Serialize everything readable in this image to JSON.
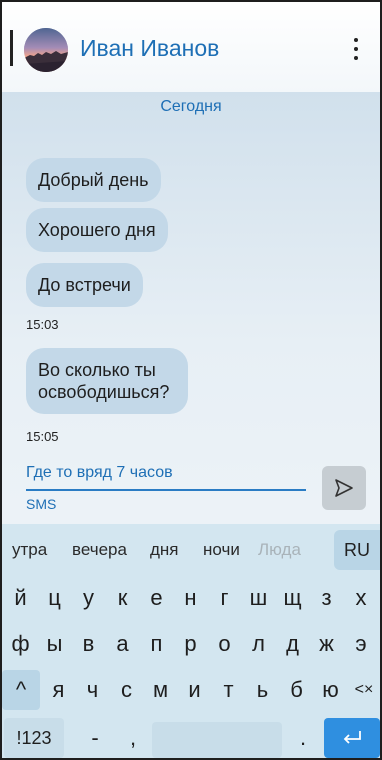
{
  "header": {
    "contact_name": "Иван Иванов"
  },
  "chat": {
    "date_separator": "Сегодня",
    "messages": [
      {
        "text": "Добрый день"
      },
      {
        "text": "Хорошего дня"
      },
      {
        "text": "До встречи",
        "time": "15:03"
      },
      {
        "text": "Во сколько ты освободишься?",
        "time": "15:05"
      }
    ]
  },
  "composer": {
    "value": "Где то вряд 7 часов",
    "sim_label": "SMS"
  },
  "keyboard": {
    "suggestions": [
      "утра",
      "вечера",
      "дня",
      "ночи",
      "Люда"
    ],
    "language": "RU",
    "row1": [
      "й",
      "ц",
      "у",
      "к",
      "е",
      "н",
      "г",
      "ш",
      "щ",
      "з",
      "х"
    ],
    "row2": [
      "ф",
      "ы",
      "в",
      "а",
      "п",
      "р",
      "о",
      "л",
      "д",
      "ж",
      "э"
    ],
    "row3": [
      "я",
      "ч",
      "с",
      "м",
      "и",
      "т",
      "ь",
      "б",
      "ю"
    ],
    "shift_glyph": "^",
    "backspace_glyph": "<×",
    "symbols_label": "!123",
    "dash_key": "-",
    "comma_key": ",",
    "period_key": "."
  },
  "colors": {
    "accent": "#1e6fb5",
    "bubble": "#c3d8e8",
    "keyboard_bg": "#d3e6f0",
    "enter_key": "#2f8fe0"
  },
  "icons": {
    "menu": "more-vertical-icon",
    "send": "send-icon",
    "enter": "enter-icon"
  }
}
